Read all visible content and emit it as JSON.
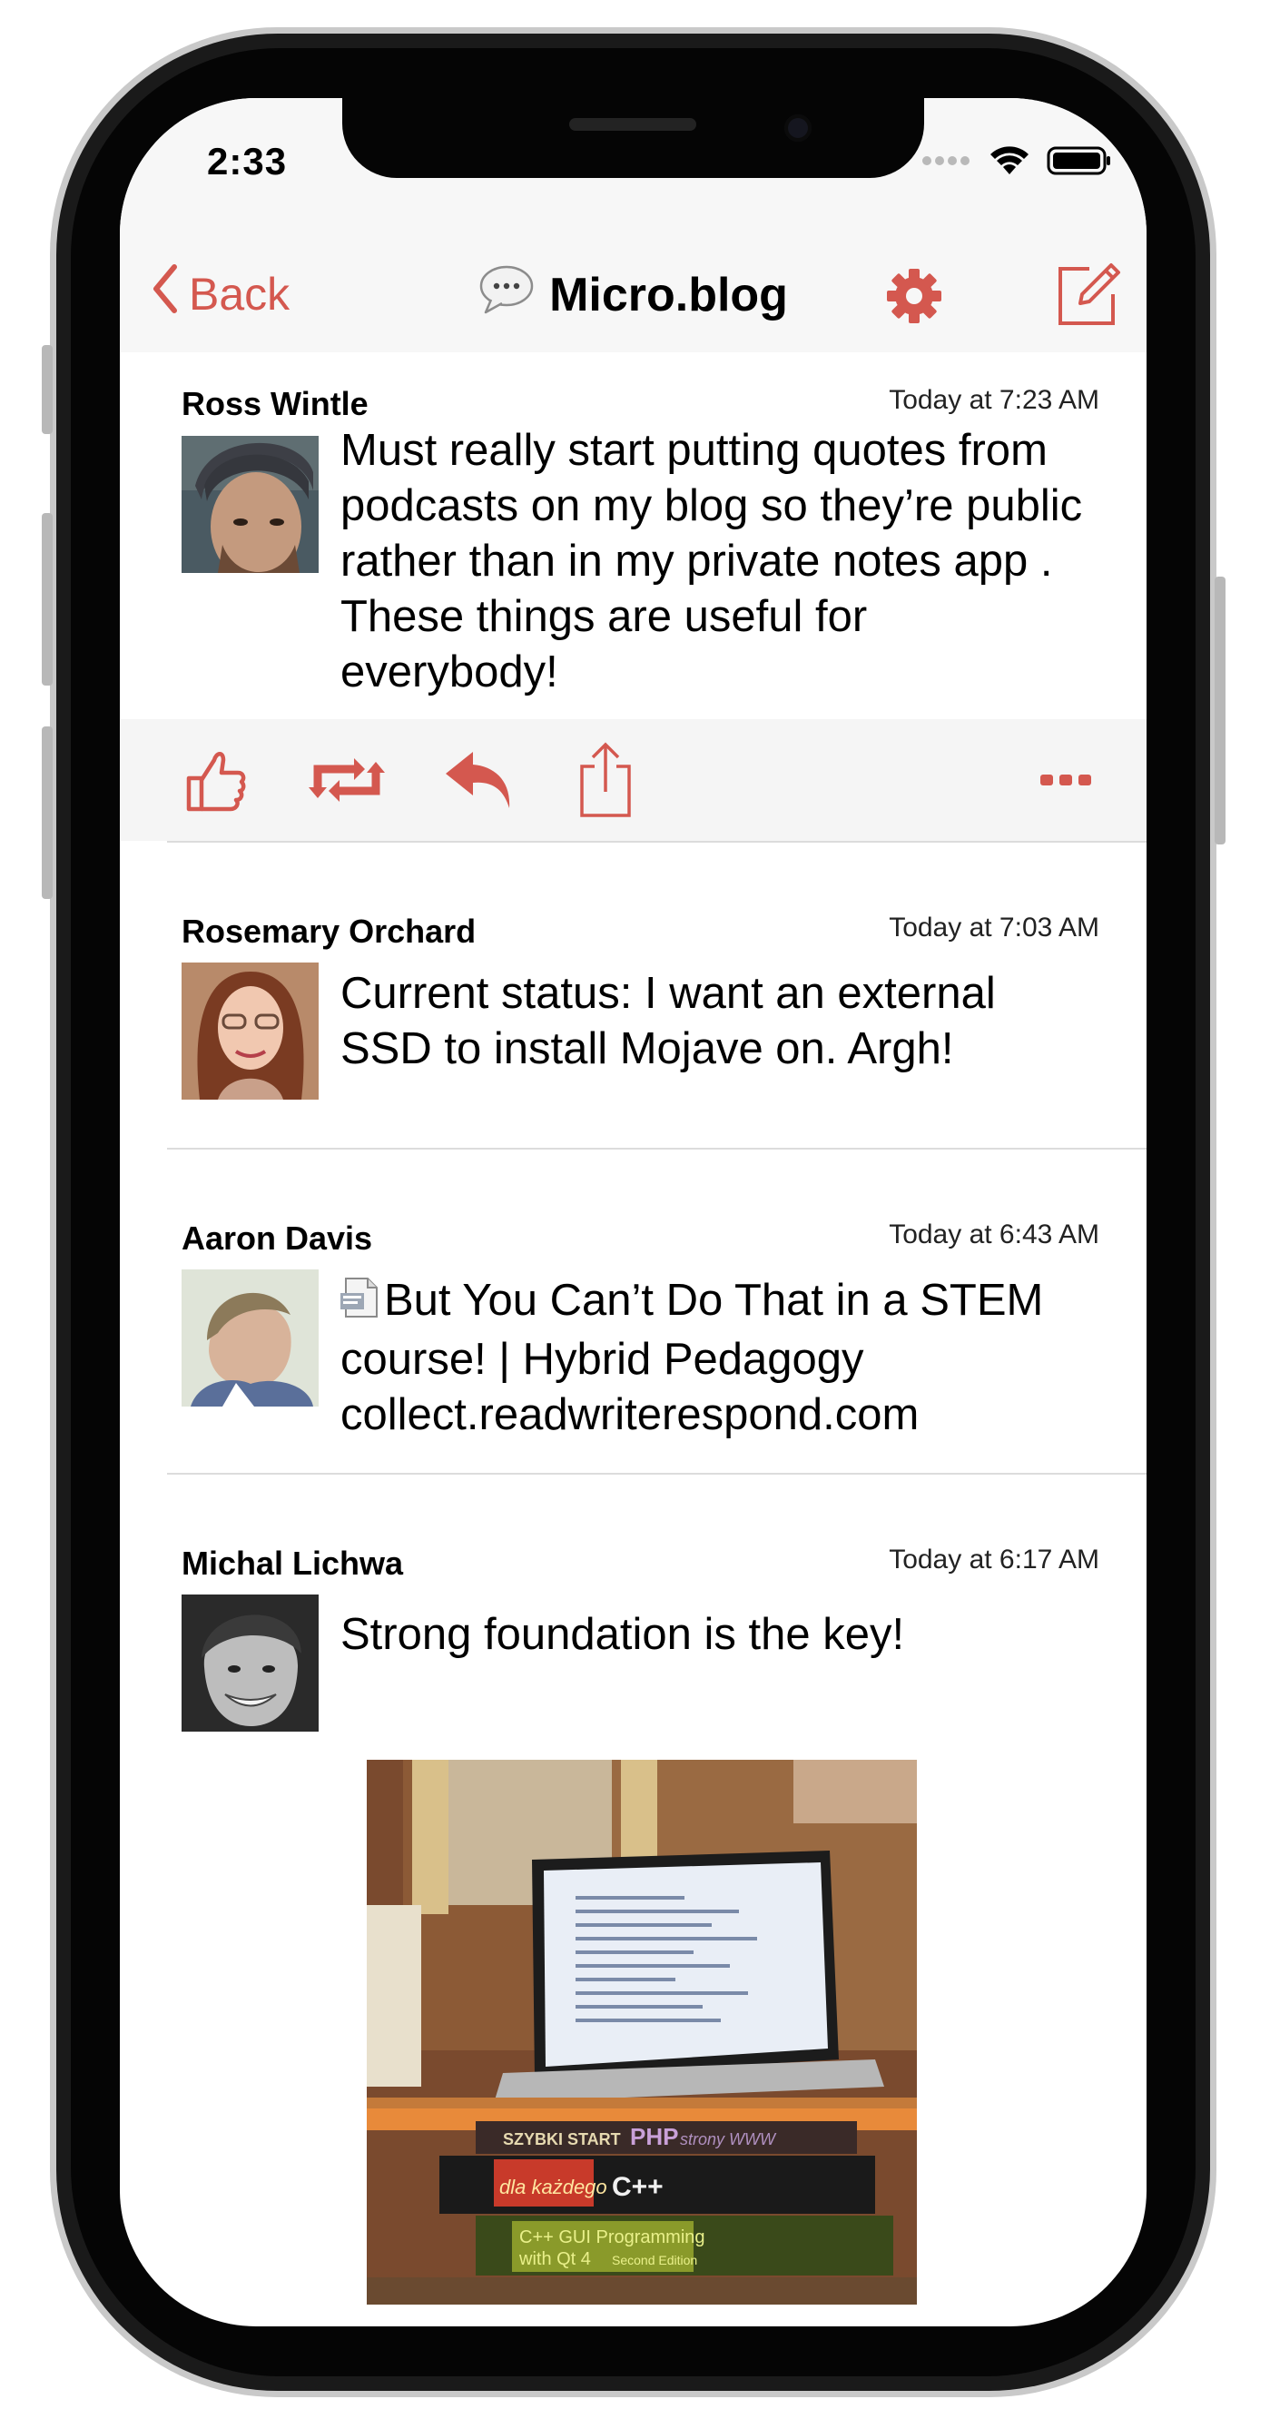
{
  "status": {
    "time": "2:33"
  },
  "nav": {
    "back_label": "Back",
    "title": "Micro.blog"
  },
  "posts": [
    {
      "author": "Ross Wintle",
      "time": "Today at 7:23 AM",
      "text": "Must really start putting quotes from podcasts on my blog so they’re public rather than in my private notes app .  These things are useful for everybody!"
    },
    {
      "author": "Rosemary Orchard",
      "time": "Today at 7:03 AM",
      "text": "Current status: I want an external SSD to install Mojave on. Argh!"
    },
    {
      "author": "Aaron Davis",
      "time": "Today at 6:43 AM",
      "text": "But You Can’t Do That in a STEM course! | Hybrid Pedagogy collect.readwriterespond.com"
    },
    {
      "author": "Michal Lichwa",
      "time": "Today at 6:17 AM",
      "text": "Strong foundation is the key!"
    }
  ],
  "photo": {
    "book_labels": [
      "SZYBKI START",
      "PHP",
      "strony WWW",
      "dla każdego",
      "C++",
      "C++ GUI Programming",
      "with Qt 4",
      "Second Edition"
    ]
  },
  "colors": {
    "accent": "#d4584f",
    "navbar_bg": "#f7f7f7",
    "actionbar_bg": "#f5f5f5",
    "divider": "#dcdcdc"
  },
  "icons": {
    "back": "chevron-left-icon",
    "app": "speech-bubble-icon",
    "settings": "gear-icon",
    "compose": "compose-icon",
    "like": "thumbs-up-icon",
    "repost": "repost-icon",
    "reply": "reply-icon",
    "share": "share-icon",
    "more": "more-icon",
    "link": "document-icon"
  }
}
